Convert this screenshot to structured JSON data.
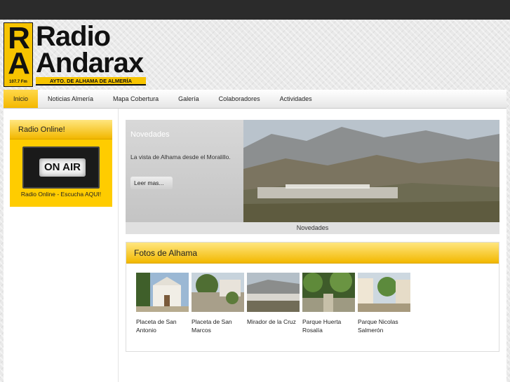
{
  "brand": {
    "logo_letters": [
      "R",
      "A"
    ],
    "frequency": "107.7 Fm",
    "name_line1": "Radio",
    "name_line2": "Andarax",
    "tagline": "AYTO. DE ALHAMA DE ALMERÍA",
    "colors": {
      "accent": "#f7c400",
      "dark": "#111111"
    }
  },
  "nav": {
    "items": [
      {
        "label": "Inicio",
        "active": true
      },
      {
        "label": "Noticias Almería",
        "active": false
      },
      {
        "label": "Mapa Cobertura",
        "active": false
      },
      {
        "label": "Galería",
        "active": false
      },
      {
        "label": "Colaboradores",
        "active": false
      },
      {
        "label": "Actividades",
        "active": false
      }
    ]
  },
  "sidebar": {
    "radio_title": "Radio Online!",
    "on_air_text": "ON AIR",
    "radio_caption": "Radio Online - Escucha AQUI!"
  },
  "slider": {
    "title": "Novedades",
    "description": "La vista de Alhama desde el Moralillo.",
    "read_more": "Leer mas...",
    "caption": "Novedades"
  },
  "fotos": {
    "title": "Fotos de Alhama",
    "items": [
      {
        "label": "Placeta de San Antonio"
      },
      {
        "label": "Placeta de San Marcos"
      },
      {
        "label": "Mirador de la Cruz"
      },
      {
        "label": "Parque Huerta Rosalía"
      },
      {
        "label": "Parque Nicolas Salmerón"
      }
    ]
  }
}
